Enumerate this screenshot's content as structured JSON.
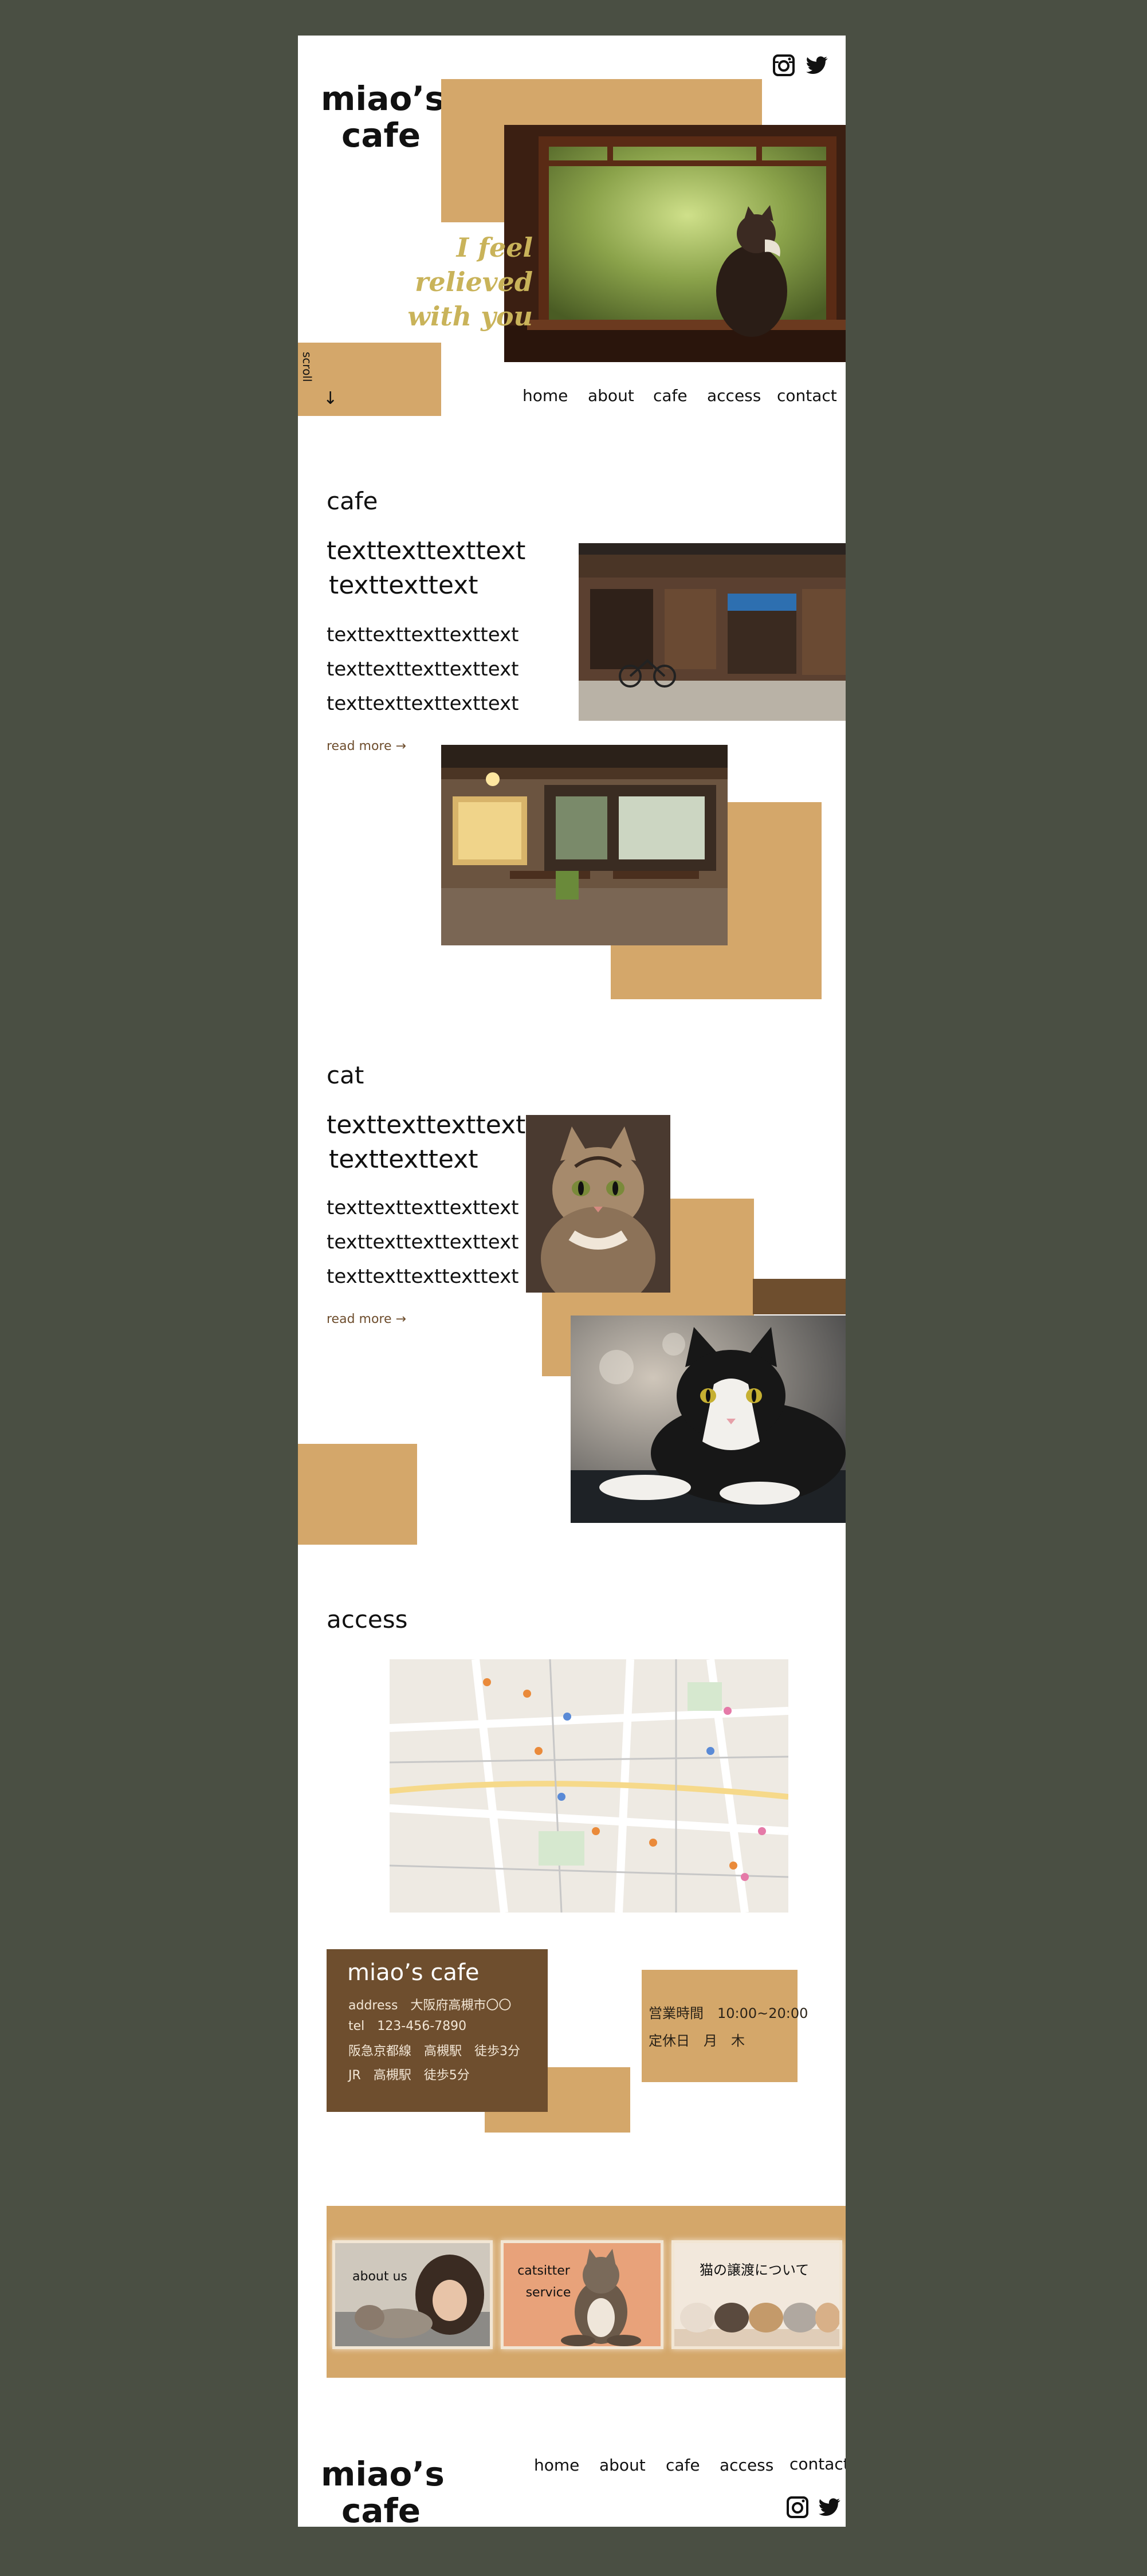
{
  "header": {
    "logo_line1": "miao’s",
    "logo_line2": "cafe",
    "tagline_line1": "I feel relieved",
    "tagline_line2": "with you",
    "scroll_label": "scroll",
    "scroll_arrow": "↓",
    "social_icons": [
      "instagram-icon",
      "twitter-icon"
    ]
  },
  "nav": {
    "items": [
      "home",
      "about",
      "cafe",
      "access",
      "contact"
    ]
  },
  "cafe": {
    "title": "cafe",
    "heading_line1": "texttexttexttext",
    "heading_line2": "texttexttext",
    "body_lines": [
      "texttexttexttexttext",
      "texttexttexttexttext",
      "texttexttexttexttext"
    ],
    "read_more": "read more →"
  },
  "cat": {
    "title": "cat",
    "heading_line1": "texttexttexttext",
    "heading_line2": "texttexttext",
    "body_lines": [
      "texttexttexttexttext",
      "texttexttexttexttext",
      "texttexttexttexttext"
    ],
    "read_more": "read more →"
  },
  "access": {
    "title": "access",
    "card_name": "miao’s cafe",
    "address": "address　大阪府高槻市〇〇",
    "tel": "tel　123-456-7890",
    "route1": "阪急京都線　高槻駅　徒歩3分",
    "route2": "JR　高槻駅　徒歩5分",
    "hours": "営業時間　10:00~20:00",
    "closed": "定休日　月　木"
  },
  "banners": {
    "about_us": "about us",
    "catsitter_line1": "catsitter",
    "catsitter_line2": "service",
    "adoption": "猫の譲渡について"
  },
  "footer": {
    "logo_line1": "miao’s",
    "logo_line2": "cafe",
    "nav": [
      "home",
      "about",
      "cafe",
      "access",
      "contact"
    ]
  },
  "colors": {
    "background": "#4a4f43",
    "page": "#ffffff",
    "accent_tan": "#d4a76a",
    "accent_brown": "#6e4e2e",
    "tagline": "#c9b35a"
  }
}
